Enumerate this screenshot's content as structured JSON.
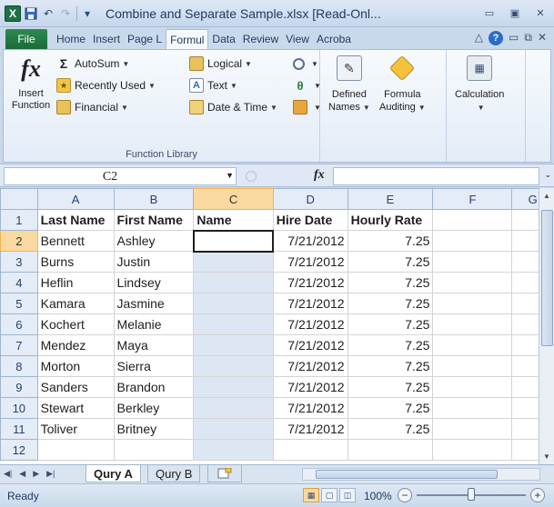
{
  "window": {
    "title": "Combine and Separate Sample.xlsx  [Read-Onl...",
    "app_logo": "X",
    "colors": {
      "excel_green": "#1e7145",
      "selection_orange": "#f9d99f",
      "selected_col": "#dde7f4"
    }
  },
  "quick_access": {
    "icons": [
      "save-icon",
      "undo-icon",
      "redo-icon",
      "customize-qat-icon"
    ]
  },
  "tabs": [
    {
      "label": "File"
    },
    {
      "label": "Home"
    },
    {
      "label": "Insert"
    },
    {
      "label": "Page L"
    },
    {
      "label": "Formul"
    },
    {
      "label": "Data"
    },
    {
      "label": "Review"
    },
    {
      "label": "View"
    },
    {
      "label": "Acroba"
    }
  ],
  "ribbon": {
    "insert_function": {
      "line1": "Insert",
      "line2": "Function"
    },
    "library": {
      "autosum": "AutoSum",
      "recently_used": "Recently Used",
      "financial": "Financial",
      "logical": "Logical",
      "text": "Text",
      "date_time": "Date & Time"
    },
    "group_label": "Function Library",
    "defined_names": {
      "line1": "Defined",
      "line2": "Names"
    },
    "formula_auditing": {
      "line1": "Formula",
      "line2": "Auditing"
    },
    "calculation": {
      "line1": "Calculation"
    }
  },
  "formula_bar": {
    "name_box": "C2",
    "fx": "fx",
    "value": ""
  },
  "grid": {
    "columns": [
      "A",
      "B",
      "C",
      "D",
      "E",
      "F",
      "G"
    ],
    "selected_column": "C",
    "active_cell": "C2",
    "row_numbers": [
      "1",
      "2",
      "3",
      "4",
      "5",
      "6",
      "7",
      "8",
      "9",
      "10",
      "11",
      "12"
    ],
    "header_row": [
      "Last Name",
      "First Name",
      "Name",
      "Hire Date",
      "Hourly Rate"
    ],
    "rows": [
      [
        "Bennett",
        "Ashley",
        "",
        "7/21/2012",
        "7.25"
      ],
      [
        "Burns",
        "Justin",
        "",
        "7/21/2012",
        "7.25"
      ],
      [
        "Heflin",
        "Lindsey",
        "",
        "7/21/2012",
        "7.25"
      ],
      [
        "Kamara",
        "Jasmine",
        "",
        "7/21/2012",
        "7.25"
      ],
      [
        "Kochert",
        "Melanie",
        "",
        "7/21/2012",
        "7.25"
      ],
      [
        "Mendez",
        "Maya",
        "",
        "7/21/2012",
        "7.25"
      ],
      [
        "Morton",
        "Sierra",
        "",
        "7/21/2012",
        "7.25"
      ],
      [
        "Sanders",
        "Brandon",
        "",
        "7/21/2012",
        "7.25"
      ],
      [
        "Stewart",
        "Berkley",
        "",
        "7/21/2012",
        "7.25"
      ],
      [
        "Toliver",
        "Britney",
        "",
        "7/21/2012",
        "7.25"
      ]
    ]
  },
  "sheets": [
    {
      "label": "Qury A",
      "active": true
    },
    {
      "label": "Qury B",
      "active": false
    }
  ],
  "status": {
    "text": "Ready",
    "zoom": "100%"
  }
}
